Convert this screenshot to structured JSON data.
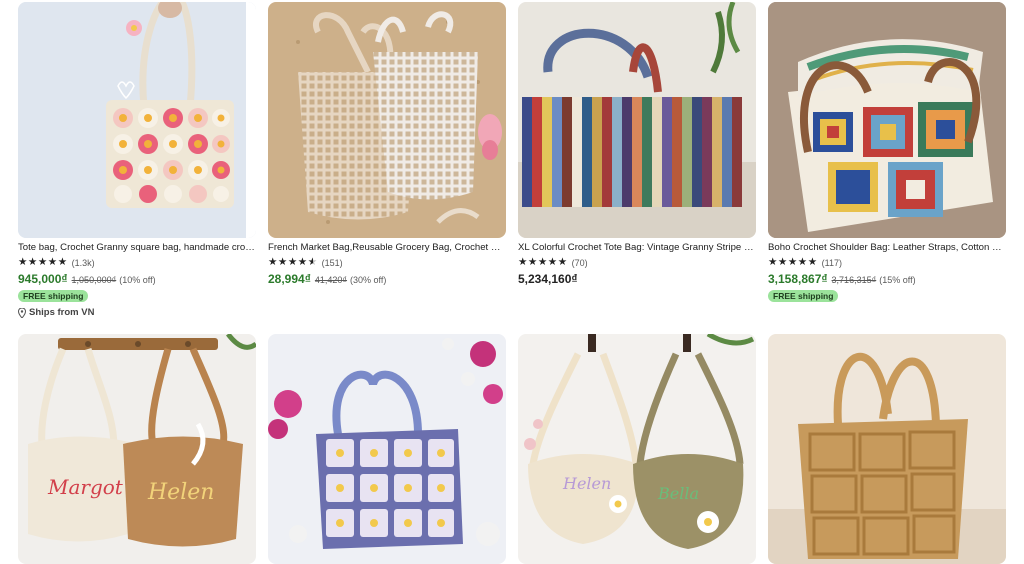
{
  "listings": [
    {
      "title": "Tote bag, Crochet Granny square bag, handmade crochet bag",
      "rating_count": "(1.3k)",
      "price": "945,000₫",
      "original_price": "1,050,000₫",
      "discount": "(10% off)",
      "badge": "FREE shipping",
      "ships_from": "Ships from VN",
      "stars": 5
    },
    {
      "title": "French Market Bag,Reusable Grocery Bag, Crochet Mesh Bag",
      "rating_count": "(151)",
      "price": "28,994₫",
      "original_price": "41,420₫",
      "discount": "(30% off)",
      "stars": 4.5
    },
    {
      "title": "XL Colorful Crochet Tote Bag: Vintage Granny Stripe Bag",
      "rating_count": "(70)",
      "price": "5,234,160₫",
      "stars": 5
    },
    {
      "title": "Boho Crochet Shoulder Bag: Leather Straps, Cotton Granny Square",
      "rating_count": "(117)",
      "price": "3,158,867₫",
      "original_price": "3,716,315₫",
      "discount": "(15% off)",
      "badge": "FREE shipping",
      "stars": 5
    },
    {
      "image_text": [
        "Margot",
        "Helen"
      ]
    },
    {},
    {
      "image_text": [
        "Helen",
        "Bella"
      ]
    },
    {}
  ],
  "colors": {
    "sale_price": "#2b7a2b",
    "badge_bg": "#9be39b",
    "text": "#222222"
  }
}
